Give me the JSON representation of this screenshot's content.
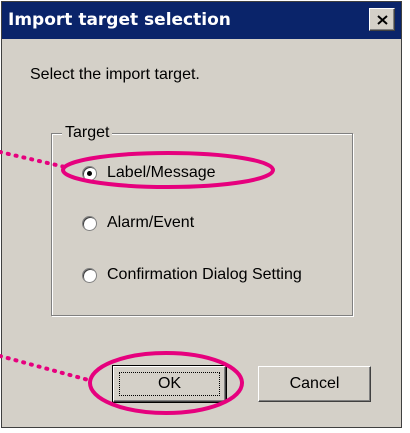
{
  "window": {
    "title": "Import target selection",
    "close_glyph": "✕"
  },
  "prompt": "Select the import target.",
  "target_group": {
    "label": "Target",
    "options": [
      {
        "label": "Label/Message",
        "selected": true
      },
      {
        "label": "Alarm/Event",
        "selected": false
      },
      {
        "label": "Confirmation Dialog Setting",
        "selected": false
      }
    ]
  },
  "buttons": {
    "ok_label": "OK",
    "cancel_label": "Cancel"
  },
  "annotation": {
    "highlight_color": "#e6007e"
  }
}
